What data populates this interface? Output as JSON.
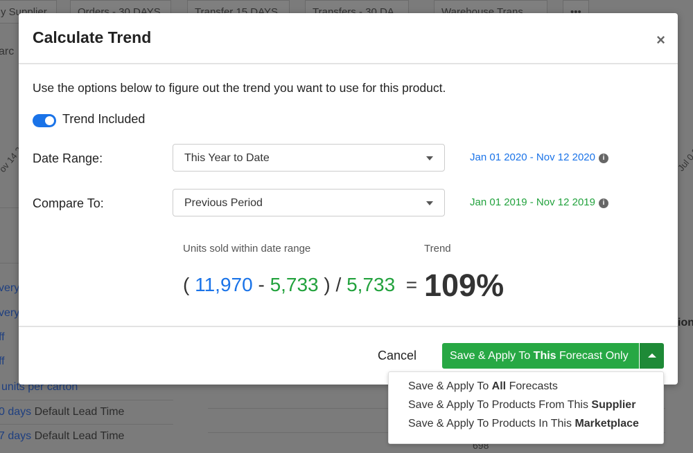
{
  "background": {
    "tabs": [
      "y Supplier",
      "Orders - 30 DAYS",
      "Transfer 15 DAYS",
      "Transfers - 30 DA",
      "Warehouse Trans",
      "•••"
    ],
    "search_fragment": "arc",
    "date_fragment_left": "ov 14 2019",
    "date_fragment_right": "Jul 0 2020",
    "list": [
      "very",
      "very",
      "ff",
      "ff",
      "units per carton"
    ],
    "lead_times": [
      {
        "value": "0 days",
        "label": "Default Lead Time"
      },
      {
        "value": "7 days",
        "label": "Default Lead Time"
      }
    ],
    "right_header_fragment": "ion",
    "bottom_value": "698"
  },
  "modal": {
    "title": "Calculate Trend",
    "close": "×",
    "intro": "Use the options below to figure out the trend you want to use for this product.",
    "toggle": {
      "label": "Trend Included",
      "on": true
    },
    "date_range": {
      "label": "Date Range:",
      "value": "This Year to Date",
      "range": "Jan 01 2020 - Nov 12 2020"
    },
    "compare_to": {
      "label": "Compare To:",
      "value": "Previous Period",
      "range": "Jan 01 2019 - Nov 12 2019"
    },
    "units_label": "Units sold within date range",
    "trend_label": "Trend",
    "formula": {
      "current": "11,970",
      "previous": "5,733",
      "divisor": "5,733"
    },
    "trend_value": "109%",
    "cancel": "Cancel",
    "save": {
      "prefix": "Save & Apply To ",
      "bold": "This",
      "suffix": " Forecast Only"
    },
    "menu": [
      {
        "prefix": "Save & Apply To ",
        "bold": "All",
        "suffix": " Forecasts"
      },
      {
        "prefix": "Save & Apply To Products From This ",
        "bold": "Supplier",
        "suffix": ""
      },
      {
        "prefix": "Save & Apply To Products In This ",
        "bold": "Marketplace",
        "suffix": ""
      }
    ]
  },
  "colors": {
    "accent_blue": "#1a73e8",
    "green": "#27a844",
    "overlay": "#7b7b7b"
  }
}
